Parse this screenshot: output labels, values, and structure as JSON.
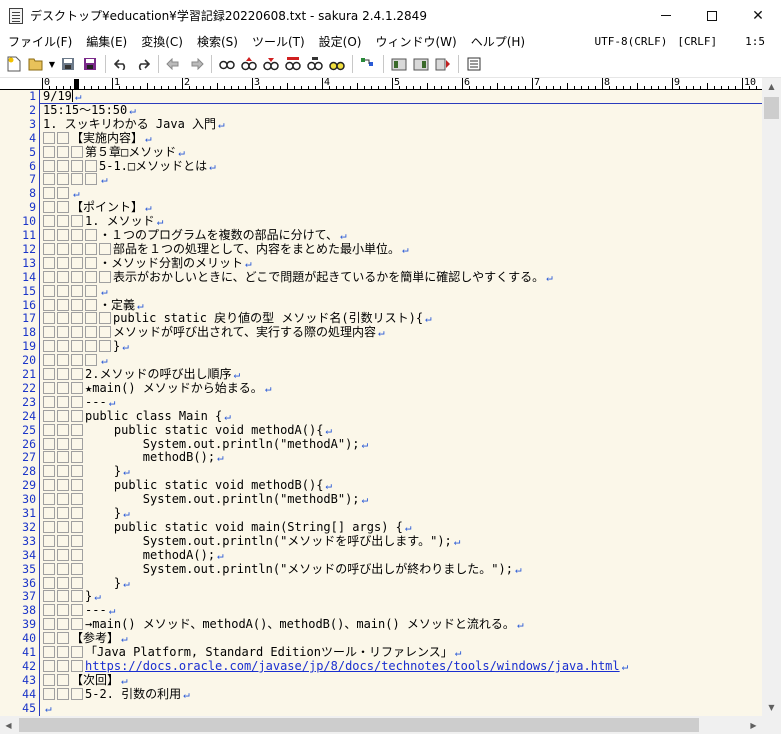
{
  "window": {
    "title": "デスクトップ¥education¥学習記録20220608.txt - sakura 2.4.1.2849",
    "minimize_label": "",
    "close_label": "✕"
  },
  "menu": {
    "items": [
      "ファイル(F)",
      "編集(E)",
      "変換(C)",
      "検索(S)",
      "ツール(T)",
      "設定(O)",
      "ウィンドウ(W)",
      "ヘルプ(H)"
    ],
    "encoding": "UTF-8(CRLF)",
    "newline": "[CRLF]",
    "position": "1:5"
  },
  "toolbar": {
    "icons": [
      "new-file-icon",
      "open-folder-icon",
      "dropdown-icon",
      "save-icon",
      "save-all-icon",
      "undo-icon",
      "redo-icon",
      "jump-back-icon",
      "jump-forward-icon",
      "search-icon",
      "search-prev-icon",
      "search-next-icon",
      "replace-icon",
      "grep-icon",
      "grep-replace-icon",
      "outline-icon",
      "compare-icon",
      "macro-icon",
      "macro-run-icon",
      "settings-icon"
    ]
  },
  "ruler": {
    "labels": [
      "0",
      "1",
      "2",
      "3",
      "4",
      "5",
      "6",
      "7",
      "8",
      "9",
      "10"
    ]
  },
  "editor": {
    "lines": [
      {
        "num": "1",
        "ws": 0,
        "text": "9/19",
        "crlf": true,
        "caret": true
      },
      {
        "num": "2",
        "ws": 0,
        "text": "15:15〜15:50",
        "crlf": true
      },
      {
        "num": "3",
        "ws": 0,
        "text": "1. スッキリわかる Java 入門",
        "crlf": true
      },
      {
        "num": "4",
        "ws": 2,
        "text": "【実施内容】",
        "crlf": true
      },
      {
        "num": "5",
        "ws": 3,
        "text": "第５章□メソッド",
        "crlf": true
      },
      {
        "num": "6",
        "ws": 4,
        "text": "5-1.□メソッドとは",
        "crlf": true
      },
      {
        "num": "7",
        "ws": 4,
        "text": "",
        "crlf": true
      },
      {
        "num": "8",
        "ws": 2,
        "text": "",
        "crlf": true
      },
      {
        "num": "9",
        "ws": 2,
        "text": "【ポイント】",
        "crlf": true
      },
      {
        "num": "10",
        "ws": 3,
        "text": "1. メソッド",
        "crlf": true
      },
      {
        "num": "11",
        "ws": 4,
        "text": "・１つのプログラムを複数の部品に分けて、",
        "crlf": true
      },
      {
        "num": "12",
        "ws": 5,
        "text": "部品を１つの処理として、内容をまとめた最小単位。",
        "crlf": true
      },
      {
        "num": "13",
        "ws": 4,
        "text": "・メソッド分割のメリット",
        "crlf": true
      },
      {
        "num": "14",
        "ws": 5,
        "text": "表示がおかしいときに、どこで問題が起きているかを簡単に確認しやすくする。",
        "crlf": true
      },
      {
        "num": "15",
        "ws": 4,
        "text": "",
        "crlf": true
      },
      {
        "num": "16",
        "ws": 4,
        "text": "・定義",
        "crlf": true
      },
      {
        "num": "17",
        "ws": 5,
        "text": "public static 戻り値の型 メソッド名(引数リスト){",
        "crlf": true
      },
      {
        "num": "18",
        "ws": 5,
        "text": "メソッドが呼び出されて、実行する際の処理内容",
        "crlf": true
      },
      {
        "num": "19",
        "ws": 5,
        "text": "}",
        "crlf": true
      },
      {
        "num": "20",
        "ws": 4,
        "text": "",
        "crlf": true
      },
      {
        "num": "21",
        "ws": 3,
        "text": "2.メソッドの呼び出し順序",
        "crlf": true
      },
      {
        "num": "22",
        "ws": 3,
        "text": "★main() メソッドから始まる。",
        "crlf": true
      },
      {
        "num": "23",
        "ws": 3,
        "text": "---",
        "crlf": true
      },
      {
        "num": "24",
        "ws": 3,
        "text": "public class Main {",
        "crlf": true
      },
      {
        "num": "25",
        "ws": 3,
        "text": "    public static void methodA(){",
        "crlf": true
      },
      {
        "num": "26",
        "ws": 3,
        "text": "        System.out.println(\"methodA\");",
        "crlf": true
      },
      {
        "num": "27",
        "ws": 3,
        "text": "        methodB();",
        "crlf": true
      },
      {
        "num": "28",
        "ws": 3,
        "text": "    }",
        "crlf": true
      },
      {
        "num": "29",
        "ws": 3,
        "text": "    public static void methodB(){",
        "crlf": true
      },
      {
        "num": "30",
        "ws": 3,
        "text": "        System.out.println(\"methodB\");",
        "crlf": true
      },
      {
        "num": "31",
        "ws": 3,
        "text": "    }",
        "crlf": true
      },
      {
        "num": "32",
        "ws": 3,
        "text": "    public static void main(String[] args) {",
        "crlf": true
      },
      {
        "num": "33",
        "ws": 3,
        "text": "        System.out.println(\"メソッドを呼び出します。\");",
        "crlf": true
      },
      {
        "num": "34",
        "ws": 3,
        "text": "        methodA();",
        "crlf": true
      },
      {
        "num": "35",
        "ws": 3,
        "text": "        System.out.println(\"メソッドの呼び出しが終わりました。\");",
        "crlf": true
      },
      {
        "num": "36",
        "ws": 3,
        "text": "    }",
        "crlf": true
      },
      {
        "num": "37",
        "ws": 3,
        "text": "}",
        "crlf": true
      },
      {
        "num": "38",
        "ws": 3,
        "text": "---",
        "crlf": true
      },
      {
        "num": "39",
        "ws": 3,
        "text": "→main() メソッド、methodA()、methodB()、main() メソッドと流れる。",
        "crlf": true
      },
      {
        "num": "40",
        "ws": 2,
        "text": "【参考】",
        "crlf": true
      },
      {
        "num": "41",
        "ws": 3,
        "text": "「Java Platform, Standard Editionツール・リファレンス」",
        "crlf": true
      },
      {
        "num": "42",
        "ws": 3,
        "text": "https://docs.oracle.com/javase/jp/8/docs/technotes/tools/windows/java.html",
        "crlf": true,
        "url": true
      },
      {
        "num": "43",
        "ws": 2,
        "text": "【次回】",
        "crlf": true
      },
      {
        "num": "44",
        "ws": 3,
        "text": "5-2. 引数の利用",
        "crlf": true
      },
      {
        "num": "45",
        "ws": 0,
        "text": "",
        "crlf": true
      }
    ]
  }
}
